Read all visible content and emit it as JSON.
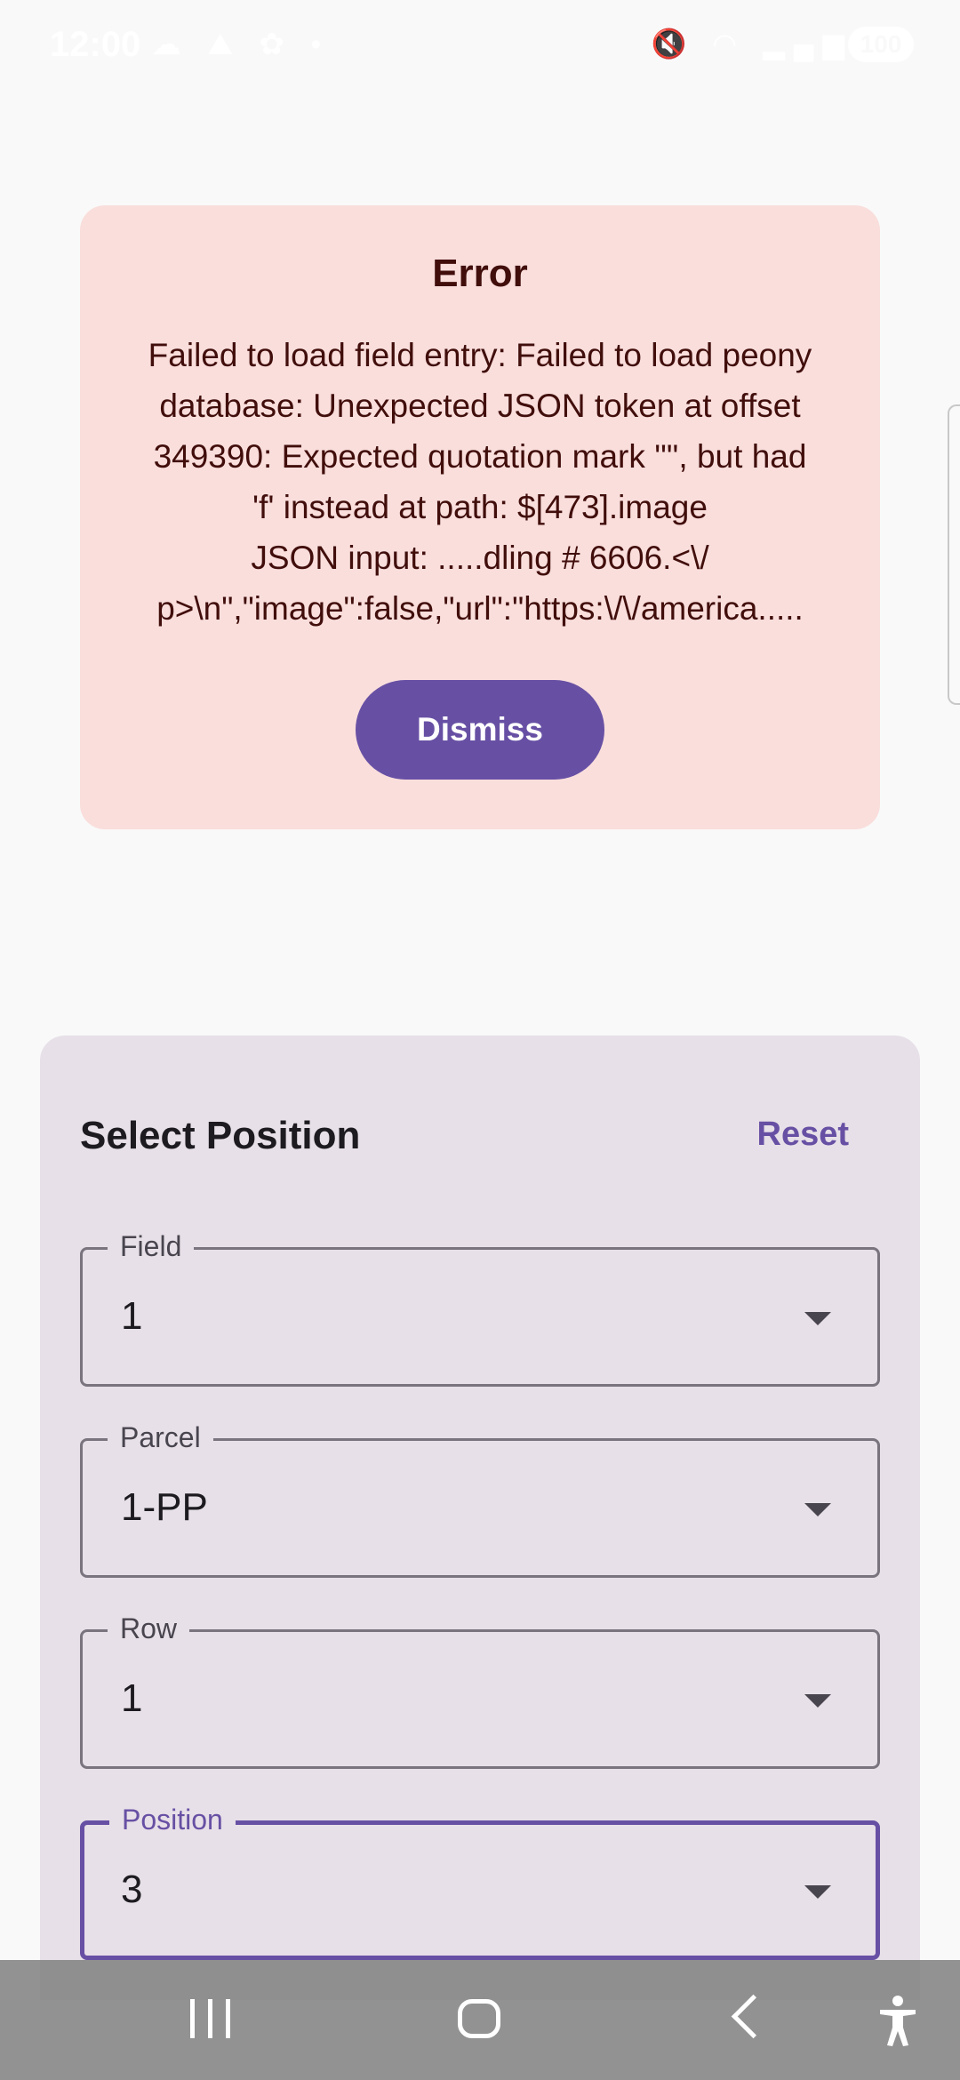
{
  "status_bar": {
    "time": "12:00",
    "battery": "100"
  },
  "error_dialog": {
    "title": "Error",
    "message": "Failed to load field entry: Failed to load peony\ndatabase: Unexpected JSON token at offset\n349390: Expected quotation mark '\"', but had\n'f' instead at path: $[473].image\nJSON input: .....dling # 6606.<\\/\np>\\n\",\"image\":false,\"url\":\"https:\\/\\/america.....",
    "dismiss_label": "Dismiss"
  },
  "position_sheet": {
    "title": "Select Position",
    "reset_label": "Reset",
    "fields": [
      {
        "label": "Field",
        "value": "1"
      },
      {
        "label": "Parcel",
        "value": "1-PP"
      },
      {
        "label": "Row",
        "value": "1"
      },
      {
        "label": "Position",
        "value": "3"
      }
    ]
  },
  "nav_bar": {
    "icons": [
      "recents-icon",
      "home-icon",
      "back-icon",
      "accessibility-icon"
    ]
  }
}
